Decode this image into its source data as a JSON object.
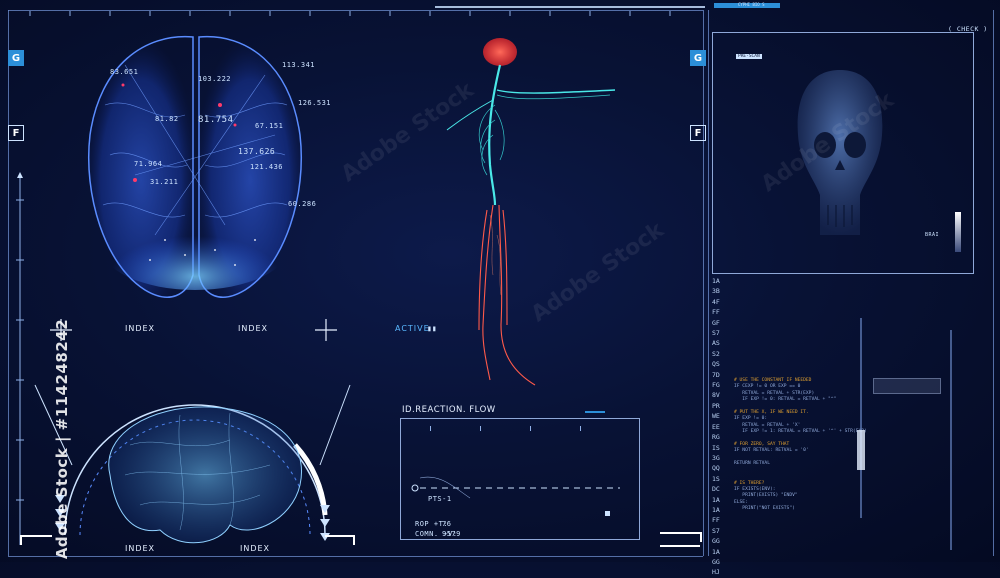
{
  "side_markers": {
    "g": "G",
    "f": "F"
  },
  "brain_top": {
    "readouts": [
      "113.341",
      "103.222",
      "126.531",
      "81.754",
      "67.151",
      "137.626",
      "121.436",
      "60.286",
      "81.82",
      "83.651",
      "71.964",
      "31.211"
    ]
  },
  "index_bar": {
    "index1": "INDEX",
    "index2": "INDEX",
    "active": "ACTIVE"
  },
  "brain_side": {
    "index1": "INDEX",
    "index2": "INDEX"
  },
  "reaction_flow": {
    "title": "ID.REACTION. FLOW",
    "pts": "PTS-1",
    "rop_label": "ROP +T:",
    "rop_value": "76",
    "comn_label": "COMN. +V:",
    "comn_value": "9579"
  },
  "right_panel": {
    "header_tag": "CYPHI BIO S",
    "check_label": "( CHECK )",
    "pre_label": "PRE-SCAN",
    "side_label": "BRAI",
    "hex_column": [
      "1A",
      "3B",
      "4F",
      "FF",
      "GF",
      "S7",
      "AS",
      "S2",
      "QS",
      "7D",
      "FG",
      "8V",
      "PR",
      "WE",
      "EE",
      "RG",
      "IS",
      "3G",
      "QQ",
      "1S",
      "DC",
      "1A",
      "1A",
      "FF",
      "S7",
      "GG",
      "1A",
      "GG",
      "HJ"
    ],
    "code_lines": [
      "# USE THE CONSTANT IF NEEDED",
      "IF CEXP != 0 OR EXP == 0",
      "   RETVAL = RETVAL + STR(EXP)",
      "   IF EXP != 0: RETVAL = RETVAL + \"^\"",
      "",
      "# PUT THE X, IF WE NEED IT.",
      "IF EXP != 0:",
      "   RETVAL = RETVAL + 'X'",
      "   IF EXP != 1: RETVAL = RETVAL + '^' + STR(EXP)",
      "",
      "# FOR ZERO, SAY THAT",
      "IF NOT RETVAL: RETVAL = '0'",
      "",
      "RETURN RETVAL",
      "",
      "",
      "# IS THERE?",
      "IF EXISTS(ENV):",
      "   PRINT(EXISTS) \"ENDV\"",
      "ELSE:",
      "   PRINT(\"NOT EXISTS\")"
    ]
  },
  "stock_id": "Adobe Stock | #114248242",
  "colors": {
    "accent": "#2c8fd8",
    "brain": "#3a7cff",
    "nerve": "#38d8d8",
    "organ": "#ff4a3a",
    "orange": "#e0a030"
  }
}
